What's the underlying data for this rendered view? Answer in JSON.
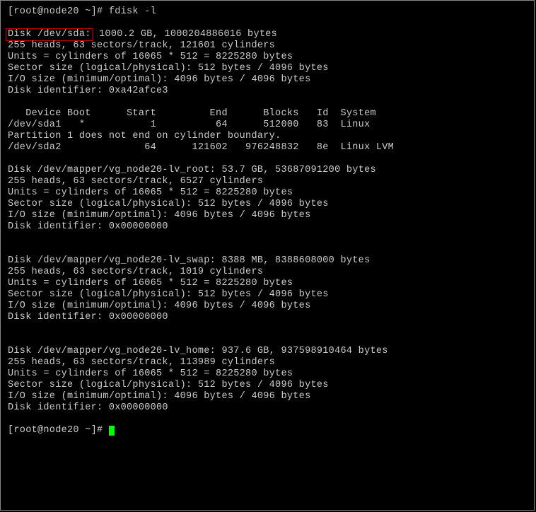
{
  "prompt1": {
    "user_host": "[root@node20 ~]#",
    "command": "fdisk -l"
  },
  "disk_sda": {
    "highlighted": "Disk /dev/sda:",
    "rest": " 1000.2 GB, 1000204886016 bytes",
    "heads": "255 heads, 63 sectors/track, 121601 cylinders",
    "units": "Units = cylinders of 16065 * 512 = 8225280 bytes",
    "sector": "Sector size (logical/physical): 512 bytes / 4096 bytes",
    "io": "I/O size (minimum/optimal): 4096 bytes / 4096 bytes",
    "ident": "Disk identifier: 0xa42afce3"
  },
  "ptable": {
    "header": "   Device Boot      Start         End      Blocks   Id  System",
    "row1": "/dev/sda1   *           1          64      512000   83  Linux",
    "warn": "Partition 1 does not end on cylinder boundary.",
    "row2": "/dev/sda2              64      121602   976248832   8e  Linux LVM"
  },
  "lv_root": {
    "title": "Disk /dev/mapper/vg_node20-lv_root: 53.7 GB, 53687091200 bytes",
    "heads": "255 heads, 63 sectors/track, 6527 cylinders",
    "units": "Units = cylinders of 16065 * 512 = 8225280 bytes",
    "sector": "Sector size (logical/physical): 512 bytes / 4096 bytes",
    "io": "I/O size (minimum/optimal): 4096 bytes / 4096 bytes",
    "ident": "Disk identifier: 0x00000000"
  },
  "lv_swap": {
    "title": "Disk /dev/mapper/vg_node20-lv_swap: 8388 MB, 8388608000 bytes",
    "heads": "255 heads, 63 sectors/track, 1019 cylinders",
    "units": "Units = cylinders of 16065 * 512 = 8225280 bytes",
    "sector": "Sector size (logical/physical): 512 bytes / 4096 bytes",
    "io": "I/O size (minimum/optimal): 4096 bytes / 4096 bytes",
    "ident": "Disk identifier: 0x00000000"
  },
  "lv_home": {
    "title": "Disk /dev/mapper/vg_node20-lv_home: 937.6 GB, 937598910464 bytes",
    "heads": "255 heads, 63 sectors/track, 113989 cylinders",
    "units": "Units = cylinders of 16065 * 512 = 8225280 bytes",
    "sector": "Sector size (logical/physical): 512 bytes / 4096 bytes",
    "io": "I/O size (minimum/optimal): 4096 bytes / 4096 bytes",
    "ident": "Disk identifier: 0x00000000"
  },
  "prompt2": {
    "user_host": "[root@node20 ~]# "
  }
}
